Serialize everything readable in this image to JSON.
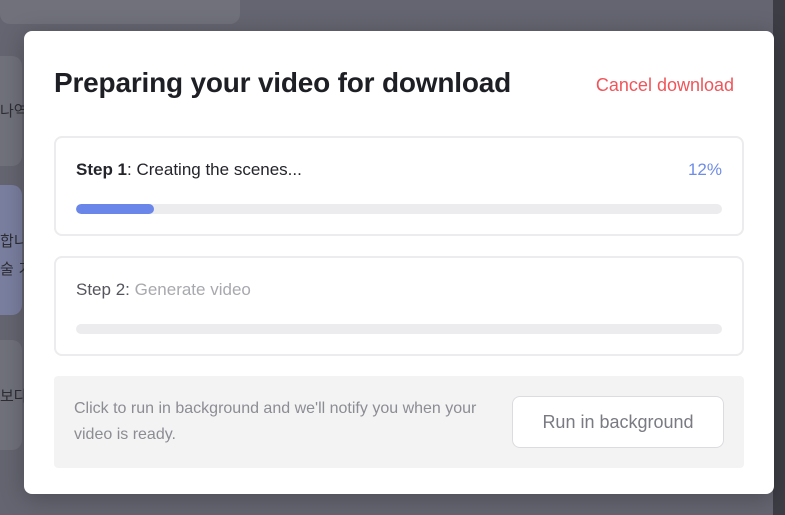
{
  "background": {
    "korean_fragments": [
      "나역",
      "합니",
      "술 가",
      "보다"
    ]
  },
  "modal": {
    "title": "Preparing your video for download",
    "cancel_label": "Cancel download",
    "steps": [
      {
        "number": "Step 1",
        "separator": ": ",
        "description": "Creating the scenes...",
        "percent_label": "12%",
        "progress": 0.12
      },
      {
        "number": "Step 2",
        "separator": ": ",
        "description": "Generate video",
        "percent_label": "",
        "progress": 0
      }
    ],
    "background_note": "Click to run in background and we'll notify you when your video is ready.",
    "run_background_label": "Run in background"
  },
  "colors": {
    "accent": "#6a86e8",
    "cancel": "#f0555a"
  }
}
